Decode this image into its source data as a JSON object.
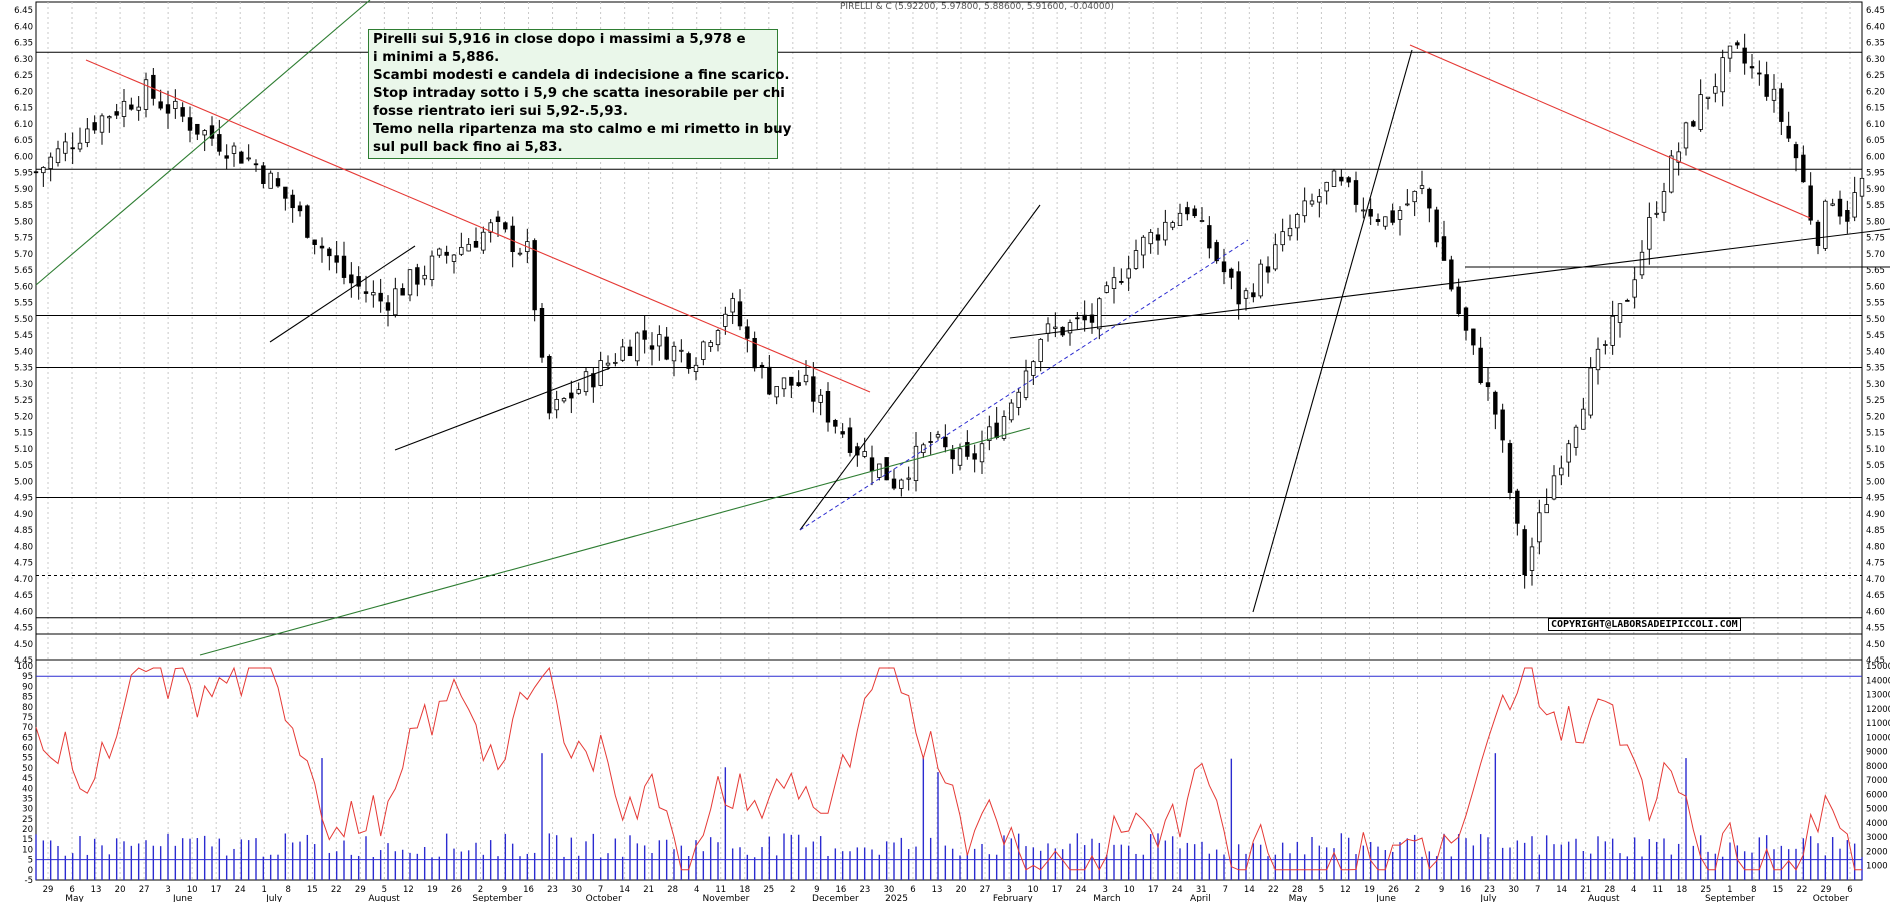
{
  "header": {
    "quote": "PIRELLI & C (5.92200, 5.97800, 5.88600, 5.91600, -0.04000)"
  },
  "note": {
    "lines": [
      "Pirelli sui 5,916 in close dopo i massimi a 5,978 e",
      "i minimi a 5,886.",
      "Scambi modesti e candela di indecisione a fine scarico.",
      "Stop intraday sotto i 5,9 che scatta inesorabile per chi",
      "fosse rientrato ieri sui 5,92-.5,93.",
      "Temo nella ripartenza ma sto calmo e mi rimetto in buy",
      "sul pull back fino ai 5,83."
    ]
  },
  "copyright": "COPYRIGHT@LABORSADEIPICCOLI.COM",
  "chart_data": [
    {
      "type": "candlestick",
      "series_name": "PIRELLI & C",
      "ylim": [
        4.45,
        6.45
      ],
      "yticks": [
        "4.45",
        "4.50",
        "4.55",
        "4.60",
        "4.65",
        "4.70",
        "4.75",
        "4.80",
        "4.85",
        "4.90",
        "4.95",
        "5.00",
        "5.05",
        "5.10",
        "5.15",
        "5.20",
        "5.25",
        "5.30",
        "5.35",
        "5.40",
        "5.45",
        "5.50",
        "5.55",
        "5.60",
        "5.65",
        "5.70",
        "5.75",
        "5.80",
        "5.85",
        "5.90",
        "5.95",
        "6.00",
        "6.05",
        "6.10",
        "6.15",
        "6.20",
        "6.25",
        "6.30",
        "6.35",
        "6.40",
        "6.45"
      ],
      "horizontal_levels": [
        6.32,
        5.96,
        5.51,
        5.35,
        4.95,
        4.71,
        4.58,
        4.53
      ],
      "dashed_levels": [
        4.71
      ],
      "last_close": 5.916,
      "close_path": [
        {
          "x": 0,
          "y": 5.95
        },
        {
          "x": 0.03,
          "y": 6.1
        },
        {
          "x": 0.06,
          "y": 6.2
        },
        {
          "x": 0.09,
          "y": 6.08
        },
        {
          "x": 0.12,
          "y": 5.98
        },
        {
          "x": 0.14,
          "y": 5.85
        },
        {
          "x": 0.17,
          "y": 5.62
        },
        {
          "x": 0.19,
          "y": 5.55
        },
        {
          "x": 0.22,
          "y": 5.68
        },
        {
          "x": 0.25,
          "y": 5.78
        },
        {
          "x": 0.27,
          "y": 5.7
        },
        {
          "x": 0.28,
          "y": 5.2
        },
        {
          "x": 0.3,
          "y": 5.3
        },
        {
          "x": 0.33,
          "y": 5.45
        },
        {
          "x": 0.36,
          "y": 5.38
        },
        {
          "x": 0.38,
          "y": 5.55
        },
        {
          "x": 0.4,
          "y": 5.3
        },
        {
          "x": 0.42,
          "y": 5.3
        },
        {
          "x": 0.45,
          "y": 5.1
        },
        {
          "x": 0.47,
          "y": 5.0
        },
        {
          "x": 0.49,
          "y": 5.12
        },
        {
          "x": 0.51,
          "y": 5.05
        },
        {
          "x": 0.53,
          "y": 5.2
        },
        {
          "x": 0.55,
          "y": 5.45
        },
        {
          "x": 0.58,
          "y": 5.5
        },
        {
          "x": 0.6,
          "y": 5.7
        },
        {
          "x": 0.63,
          "y": 5.85
        },
        {
          "x": 0.66,
          "y": 5.55
        },
        {
          "x": 0.69,
          "y": 5.8
        },
        {
          "x": 0.71,
          "y": 5.92
        },
        {
          "x": 0.74,
          "y": 5.8
        },
        {
          "x": 0.76,
          "y": 5.9
        },
        {
          "x": 0.78,
          "y": 5.5
        },
        {
          "x": 0.8,
          "y": 5.2
        },
        {
          "x": 0.815,
          "y": 4.72
        },
        {
          "x": 0.83,
          "y": 5.0
        },
        {
          "x": 0.85,
          "y": 5.3
        },
        {
          "x": 0.87,
          "y": 5.55
        },
        {
          "x": 0.89,
          "y": 5.9
        },
        {
          "x": 0.91,
          "y": 6.15
        },
        {
          "x": 0.93,
          "y": 6.32
        },
        {
          "x": 0.95,
          "y": 6.2
        },
        {
          "x": 0.965,
          "y": 5.98
        },
        {
          "x": 0.975,
          "y": 5.75
        },
        {
          "x": 0.985,
          "y": 5.9
        },
        {
          "x": 0.99,
          "y": 5.8
        },
        {
          "x": 1.0,
          "y": 5.92
        }
      ]
    },
    {
      "type": "line+bar",
      "ylim_left": [
        -5,
        100
      ],
      "ylim_right": [
        0,
        15000
      ],
      "yticks_left": [
        "-5",
        "0",
        "5",
        "10",
        "15",
        "20",
        "25",
        "30",
        "35",
        "40",
        "45",
        "50",
        "55",
        "60",
        "65",
        "70",
        "75",
        "80",
        "85",
        "90",
        "95",
        "100"
      ],
      "yticks_right": [
        "1000",
        "2000",
        "3000",
        "4000",
        "5000",
        "6000",
        "7000",
        "8000",
        "9000",
        "10000",
        "11000",
        "12000",
        "13000",
        "14000",
        "15000"
      ],
      "levels": [
        95,
        5
      ]
    }
  ],
  "x_axis": {
    "day_ticks": [
      "29",
      "6",
      "13",
      "20",
      "27",
      "3",
      "10",
      "17",
      "24",
      "1",
      "8",
      "15",
      "22",
      "29",
      "5",
      "12",
      "19",
      "26",
      "2",
      "9",
      "16",
      "23",
      "30",
      "7",
      "14",
      "21",
      "28",
      "4",
      "11",
      "18",
      "25",
      "2",
      "9",
      "16",
      "23",
      "30",
      "6",
      "13",
      "20",
      "27",
      "3",
      "10",
      "17",
      "24",
      "3",
      "10",
      "17",
      "24",
      "31",
      "7",
      "14",
      "22",
      "28",
      "5",
      "12",
      "19",
      "26",
      "2",
      "9",
      "16",
      "23",
      "30",
      "7",
      "14",
      "21",
      "28",
      "4",
      "11",
      "18",
      "25",
      "1",
      "8",
      "15",
      "22",
      "29",
      "6"
    ],
    "month_labels": [
      {
        "label": "May",
        "at": 0.016
      },
      {
        "label": "June",
        "at": 0.075
      },
      {
        "label": "July",
        "at": 0.126
      },
      {
        "label": "August",
        "at": 0.182
      },
      {
        "label": "September",
        "at": 0.239
      },
      {
        "label": "October",
        "at": 0.301
      },
      {
        "label": "November",
        "at": 0.365
      },
      {
        "label": "December",
        "at": 0.425
      },
      {
        "label": "2025",
        "at": 0.465
      },
      {
        "label": "February",
        "at": 0.524
      },
      {
        "label": "March",
        "at": 0.579
      },
      {
        "label": "April",
        "at": 0.632
      },
      {
        "label": "May",
        "at": 0.686
      },
      {
        "label": "June",
        "at": 0.734
      },
      {
        "label": "July",
        "at": 0.791
      },
      {
        "label": "August",
        "at": 0.85
      },
      {
        "label": "September",
        "at": 0.914
      },
      {
        "label": "October",
        "at": 0.973
      }
    ]
  },
  "colors": {
    "candle": "#000000",
    "resistance": "#e53935",
    "support": "#2e7d32",
    "trend": "#000000",
    "dashed": "#2b2bd0",
    "oscillator": "#e53935",
    "volume": "#2b2bd0",
    "level": "#2b2bd0"
  }
}
